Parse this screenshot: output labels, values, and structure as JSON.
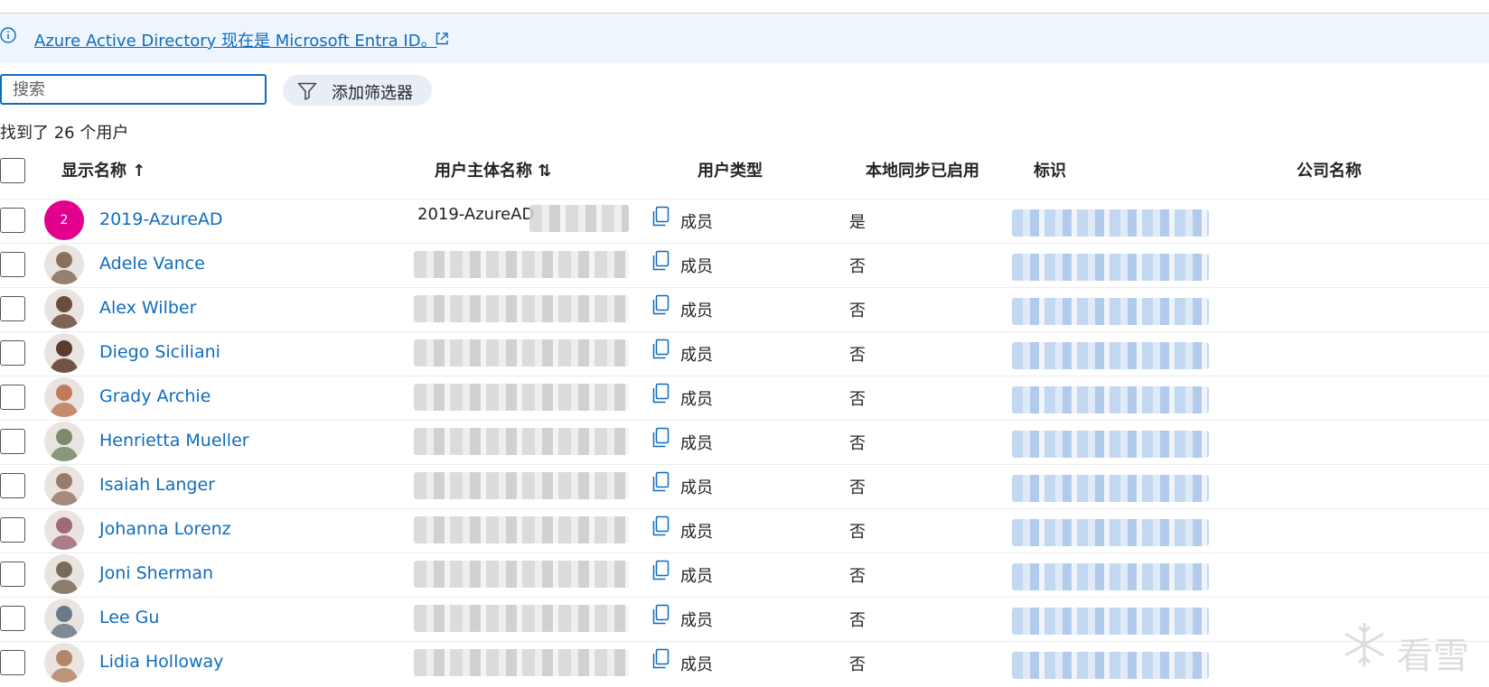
{
  "banner": {
    "text": "Azure Active Directory 现在是 Microsoft Entra ID。",
    "icon": "info-icon",
    "link_icon": "external-link-icon"
  },
  "search": {
    "placeholder": "搜索",
    "value": ""
  },
  "filter": {
    "label": "添加筛选器",
    "icon": "filter-icon"
  },
  "result_count": "找到了 26 个用户",
  "columns": {
    "display_name": "显示名称 ↑",
    "upn": "用户主体名称 ⇅",
    "user_type": "用户类型",
    "sync": "本地同步已启用",
    "identity": "标识",
    "company": "公司名称"
  },
  "users": [
    {
      "name": "2019-AzureAD",
      "upn": "2019-AzureAD",
      "user_type": "成员",
      "sync": "是",
      "avatar": "2"
    },
    {
      "name": "Adele Vance",
      "upn": "",
      "user_type": "成员",
      "sync": "否",
      "avatar": "photo"
    },
    {
      "name": "Alex Wilber",
      "upn": "",
      "user_type": "成员",
      "sync": "否",
      "avatar": "photo"
    },
    {
      "name": "Diego Siciliani",
      "upn": "",
      "user_type": "成员",
      "sync": "否",
      "avatar": "photo"
    },
    {
      "name": "Grady Archie",
      "upn": "",
      "user_type": "成员",
      "sync": "否",
      "avatar": "photo"
    },
    {
      "name": "Henrietta Mueller",
      "upn": "",
      "user_type": "成员",
      "sync": "否",
      "avatar": "photo"
    },
    {
      "name": "Isaiah Langer",
      "upn": "",
      "user_type": "成员",
      "sync": "否",
      "avatar": "photo"
    },
    {
      "name": "Johanna Lorenz",
      "upn": "",
      "user_type": "成员",
      "sync": "否",
      "avatar": "photo"
    },
    {
      "name": "Joni Sherman",
      "upn": "",
      "user_type": "成员",
      "sync": "否",
      "avatar": "photo"
    },
    {
      "name": "Lee Gu",
      "upn": "",
      "user_type": "成员",
      "sync": "否",
      "avatar": "photo"
    },
    {
      "name": "Lidia Holloway",
      "upn": "",
      "user_type": "成员",
      "sync": "否",
      "avatar": "photo"
    }
  ],
  "watermark": {
    "text": "看雪",
    "icon": "snowflake-icon"
  },
  "colors": {
    "link": "#0f6cbd",
    "banner_bg": "#eef5fc",
    "avatar_initial_bg": "#e3008c"
  }
}
